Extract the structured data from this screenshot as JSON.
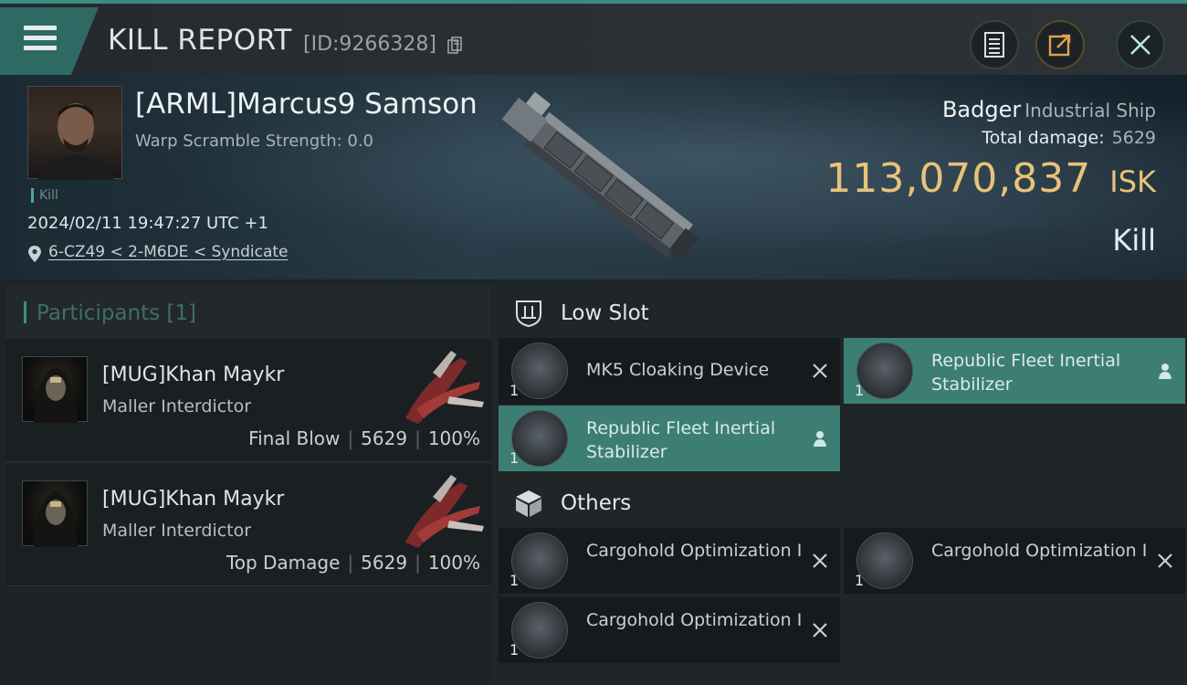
{
  "header": {
    "title": "KILL REPORT",
    "report_id": "[ID:9266328]",
    "icons": [
      "menu-icon",
      "copy-icon",
      "report-icon",
      "share-icon",
      "close-icon"
    ]
  },
  "victim": {
    "name": "[ARML]Marcus9 Samson",
    "warp_scramble": "Warp Scramble Strength: 0.0",
    "tag": "Kill",
    "datetime": "2024/02/11 19:47:27 UTC +1",
    "location": "6-CZ49 < 2-M6DE < Syndicate",
    "ship_name": "Badger",
    "ship_class": "Industrial Ship",
    "total_damage_label": "Total damage:",
    "total_damage": "5629",
    "isk_value": "113,070,837",
    "isk_unit": "ISK",
    "result": "Kill"
  },
  "participants": {
    "title": "Participants [1]",
    "items": [
      {
        "name": "[MUG]Khan Maykr",
        "ship": "Maller Interdictor",
        "role": "Final Blow",
        "damage": "5629",
        "percent": "100%"
      },
      {
        "name": "[MUG]Khan Maykr",
        "ship": "Maller Interdictor",
        "role": "Top Damage",
        "damage": "5629",
        "percent": "100%"
      }
    ]
  },
  "slots": {
    "low_slot": {
      "title": "Low Slot",
      "items": [
        {
          "name": "MK5 Cloaking Device",
          "qty": "1",
          "state": "destroyed"
        },
        {
          "name": "Republic Fleet Inertial Stabilizer",
          "qty": "1",
          "state": "dropped"
        },
        {
          "name": "Republic Fleet Inertial Stabilizer",
          "qty": "1",
          "state": "dropped"
        }
      ]
    },
    "others": {
      "title": "Others",
      "items": [
        {
          "name": "Cargohold Optimization I",
          "qty": "1",
          "state": "destroyed"
        },
        {
          "name": "Cargohold Optimization I",
          "qty": "1",
          "state": "destroyed"
        },
        {
          "name": "Cargohold Optimization I",
          "qty": "1",
          "state": "destroyed"
        }
      ]
    }
  },
  "colors": {
    "accent": "#3c7e74",
    "isk": "#e8c27a",
    "background": "#15191d"
  }
}
